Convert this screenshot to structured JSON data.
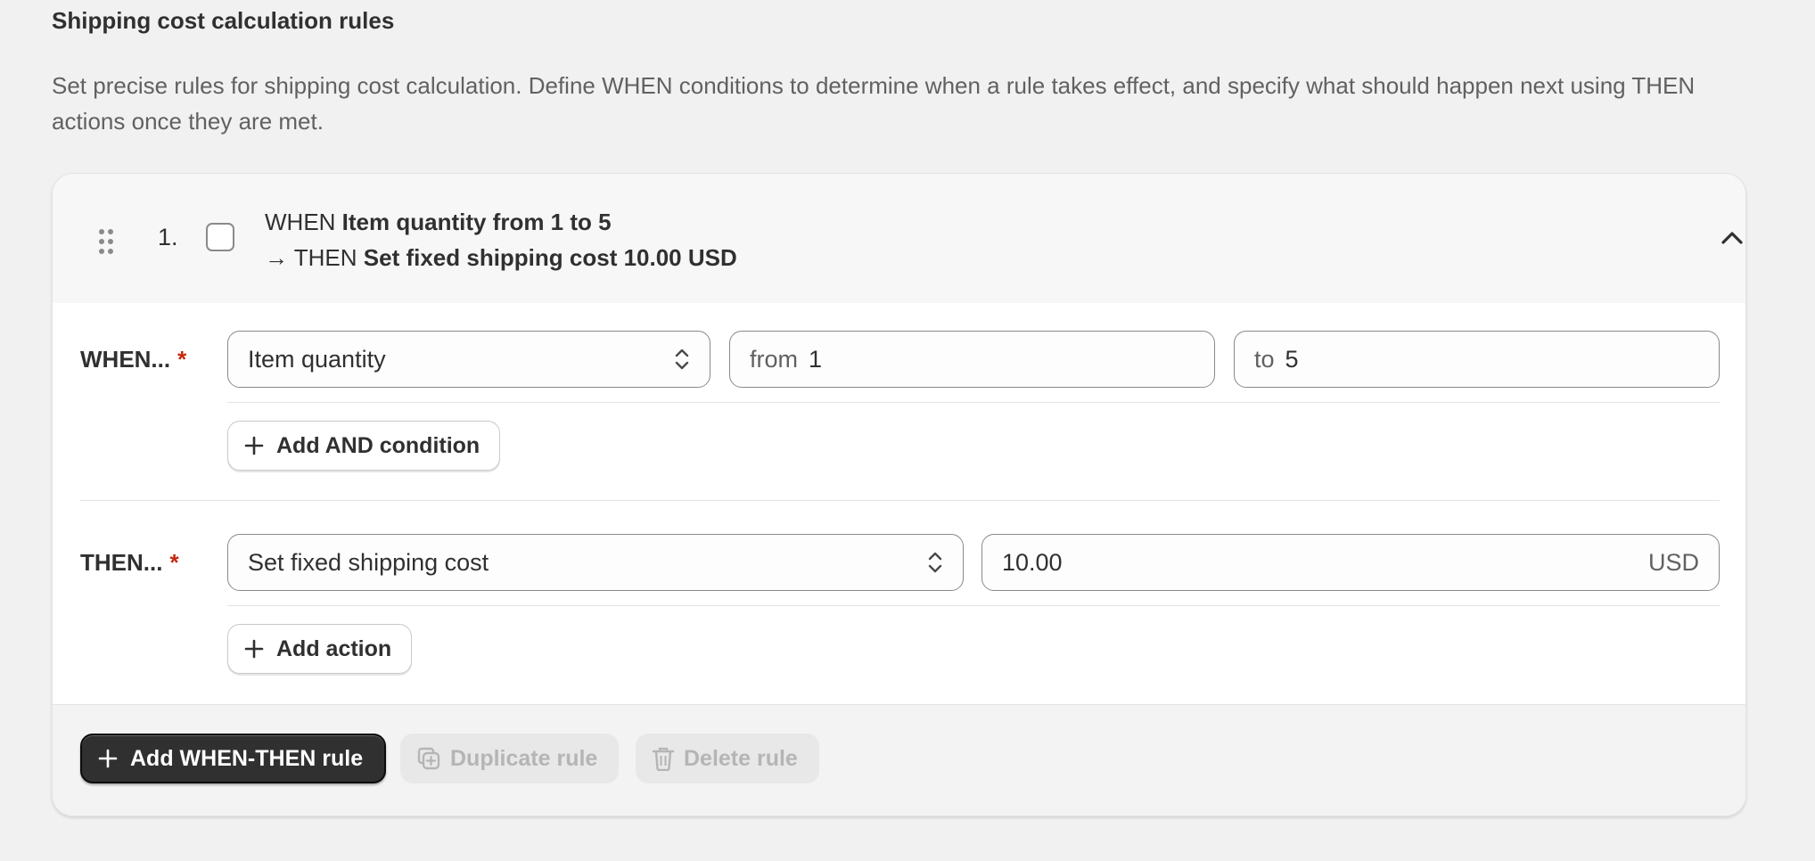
{
  "section": {
    "title": "Shipping cost calculation rules",
    "description": "Set precise rules for shipping cost calculation. Define WHEN conditions to determine when a rule takes effect, and specify what should happen next using THEN actions once they are met."
  },
  "rule": {
    "number": "1.",
    "summary_when_prefix": "WHEN",
    "summary_when_text": "Item quantity from 1 to 5",
    "summary_then_prefix": "→ THEN",
    "summary_then_text": "Set fixed shipping cost 10.00 USD",
    "selected": false,
    "expanded": true
  },
  "when": {
    "label": "WHEN...",
    "required_mark": "*",
    "condition_select": "Item quantity",
    "from_prefix": "from",
    "from_value": "1",
    "to_prefix": "to",
    "to_value": "5",
    "add_condition_label": "Add AND condition"
  },
  "then": {
    "label": "THEN...",
    "required_mark": "*",
    "action_select": "Set fixed shipping cost",
    "amount_value": "10.00",
    "currency": "USD",
    "add_action_label": "Add action"
  },
  "footer": {
    "add_rule_label": "Add WHEN-THEN rule",
    "duplicate_label": "Duplicate rule",
    "delete_label": "Delete rule"
  },
  "icons": {
    "drag": "drag-handle-icon",
    "collapse": "chevron-up-icon",
    "select": "select-arrows-icon",
    "add": "plus-icon",
    "duplicate": "duplicate-icon",
    "delete": "trash-icon"
  },
  "colors": {
    "primary_button": "#303030",
    "required": "#c5280c",
    "background": "#f1f1f1"
  }
}
